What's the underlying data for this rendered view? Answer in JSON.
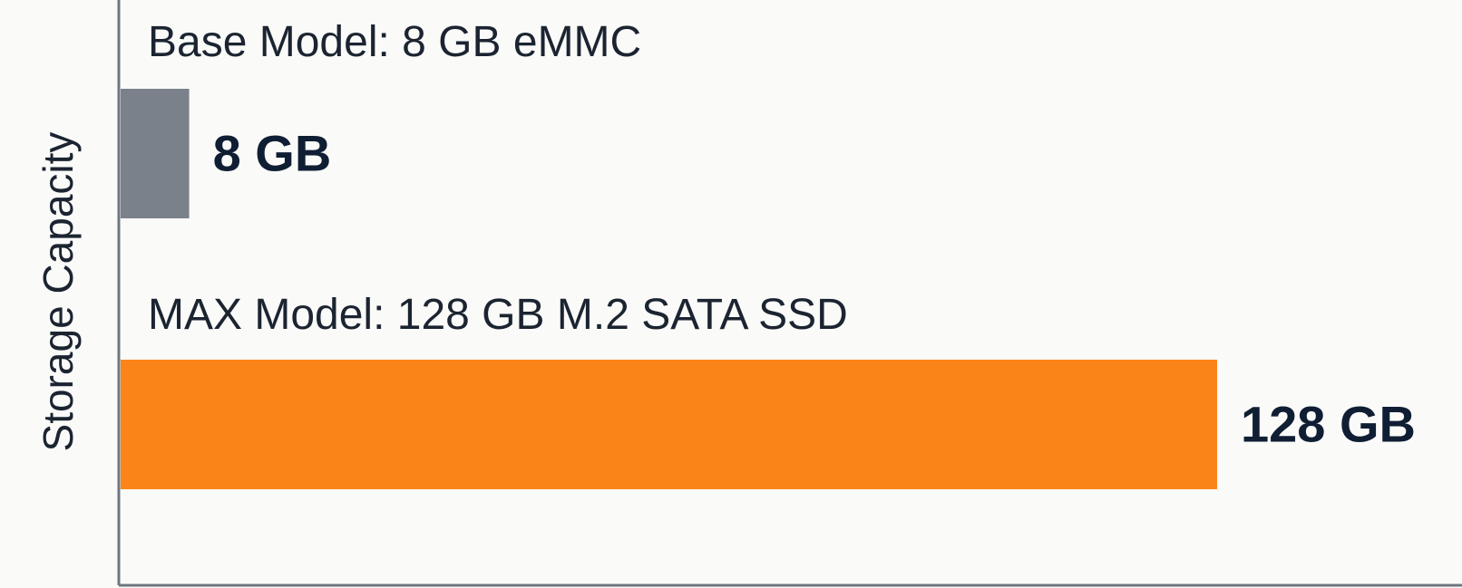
{
  "chart_data": {
    "type": "bar",
    "orientation": "horizontal",
    "ylabel": "Storage Capacity",
    "xlabel": "",
    "categories": [
      "Base Model: 8 GB eMMC",
      "MAX Model: 128 GB M.2 SATA SSD"
    ],
    "values": [
      8,
      128
    ],
    "value_labels": [
      "8 GB",
      "128 GB"
    ],
    "unit": "GB",
    "xlim": [
      0,
      140
    ],
    "grid": false,
    "legend": "none",
    "colors": {
      "bars": [
        "#7a818b",
        "#fb8418"
      ],
      "axis": "#6e7680",
      "category_text": "#1b2430",
      "value_text": "#0f1e33",
      "background": "#fafaf9"
    }
  }
}
